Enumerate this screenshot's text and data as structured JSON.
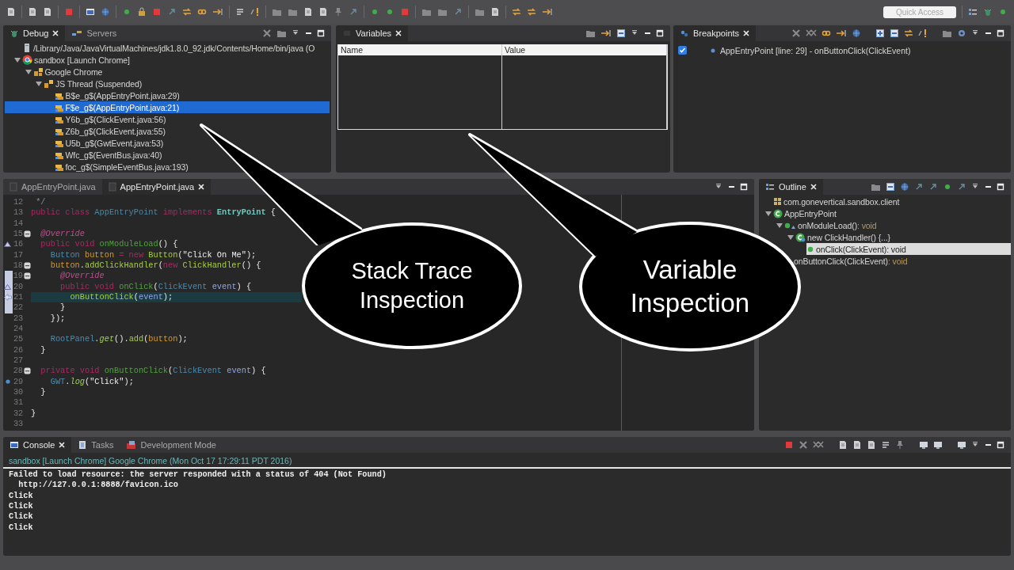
{
  "toolbar": {
    "quick_access": {
      "placeholder": "Quick Access"
    }
  },
  "debug_panel": {
    "tabs": [
      {
        "label": "Debug",
        "selected": true
      },
      {
        "label": "Servers",
        "selected": false
      }
    ],
    "tree": [
      {
        "label": "/Library/Java/JavaVirtualMachines/jdk1.8.0_92.jdk/Contents/Home/bin/java (O",
        "kind": "process",
        "selected": false
      },
      {
        "label": "sandbox [Launch Chrome]",
        "kind": "launch",
        "expanded": true,
        "selected": false,
        "children": [
          {
            "label": "Google Chrome",
            "kind": "target",
            "expanded": true,
            "selected": false,
            "children": [
              {
                "label": "JS Thread (Suspended)",
                "kind": "thread",
                "expanded": true,
                "selected": false,
                "children": [
                  {
                    "label": "B$e_g$(AppEntryPoint.java:29)",
                    "kind": "frame",
                    "selected": false
                  },
                  {
                    "label": "F$e_g$(AppEntryPoint.java:21)",
                    "kind": "frame",
                    "selected": true
                  },
                  {
                    "label": "Y6b_g$(ClickEvent.java:56)",
                    "kind": "frame",
                    "selected": false
                  },
                  {
                    "label": "Z6b_g$(ClickEvent.java:55)",
                    "kind": "frame",
                    "selected": false
                  },
                  {
                    "label": "U5b_g$(GwtEvent.java:53)",
                    "kind": "frame",
                    "selected": false
                  },
                  {
                    "label": "Wfc_g$(EventBus.java:40)",
                    "kind": "frame",
                    "selected": false
                  },
                  {
                    "label": "foc_g$(SimpleEventBus.java:193)",
                    "kind": "frame",
                    "selected": false
                  }
                ]
              }
            ]
          }
        ]
      }
    ]
  },
  "variables_panel": {
    "tabs": [
      {
        "label": "Variables",
        "selected": true
      }
    ],
    "columns": [
      "Name",
      "Value"
    ]
  },
  "breakpoints_panel": {
    "tabs": [
      {
        "label": "Breakpoints",
        "selected": true
      }
    ],
    "items": [
      {
        "label": "AppEntryPoint [line: 29] - onButtonClick(ClickEvent)",
        "checked": true
      }
    ]
  },
  "editor": {
    "tabs": [
      {
        "label": "AppEntryPoint.java",
        "selected": false
      },
      {
        "label": "AppEntryPoint.java",
        "selected": true
      }
    ],
    "lines": [
      {
        "number": "12",
        "in_range": false,
        "tokens": [
          {
            "kind": "comment",
            "text": " */"
          }
        ]
      },
      {
        "number": "13",
        "in_range": false,
        "tokens": [
          {
            "kind": "keyword",
            "text": "public class "
          },
          {
            "kind": "classname",
            "text": "AppEntryPoint "
          },
          {
            "kind": "keyword",
            "text": "implements "
          },
          {
            "kind": "interface",
            "text": "EntryPoint"
          },
          {
            "kind": "plain",
            "text": " {"
          }
        ]
      },
      {
        "number": "14",
        "in_range": false
      },
      {
        "number": "15",
        "kind": "fold",
        "in_range": false,
        "tokens": [
          {
            "kind": "annotation",
            "text": "  @Override"
          }
        ]
      },
      {
        "number": "16",
        "kind": "override",
        "in_range": false,
        "tokens": [
          {
            "kind": "keyword",
            "text": "  public void "
          },
          {
            "kind": "method",
            "text": "onModuleLoad"
          },
          {
            "kind": "plain",
            "text": "() {"
          }
        ]
      },
      {
        "number": "17",
        "in_range": false,
        "tokens": [
          {
            "kind": "type",
            "text": "    Button "
          },
          {
            "kind": "local",
            "text": "button "
          },
          {
            "kind": "keyword",
            "text": "= new "
          },
          {
            "kind": "call",
            "text": "Button"
          },
          {
            "kind": "plain",
            "text": "("
          },
          {
            "kind": "string",
            "text": "\"Click On Me\""
          },
          {
            "kind": "plain",
            "text": ");"
          }
        ]
      },
      {
        "number": "18",
        "kind": "fold",
        "in_range": false,
        "tokens": [
          {
            "kind": "local",
            "text": "    button"
          },
          {
            "kind": "plain",
            "text": "."
          },
          {
            "kind": "call",
            "text": "addClickHandler"
          },
          {
            "kind": "plain",
            "text": "("
          },
          {
            "kind": "keyword",
            "text": "new "
          },
          {
            "kind": "call",
            "text": "ClickHandler"
          },
          {
            "kind": "plain",
            "text": "() {"
          }
        ]
      },
      {
        "number": "19",
        "kind": "fold",
        "in_range": true,
        "tokens": [
          {
            "kind": "annotation",
            "text": "      @Override"
          }
        ]
      },
      {
        "number": "20",
        "kind": "override",
        "in_range": true,
        "tokens": [
          {
            "kind": "keyword",
            "text": "      public void "
          },
          {
            "kind": "method",
            "text": "onClick"
          },
          {
            "kind": "plain",
            "text": "("
          },
          {
            "kind": "type",
            "text": "ClickEvent "
          },
          {
            "kind": "param",
            "text": "event"
          },
          {
            "kind": "plain",
            "text": ") {"
          }
        ]
      },
      {
        "number": "21",
        "kind": "current",
        "in_range": true,
        "tokens": [
          {
            "kind": "call",
            "text": "        onButtonClick"
          },
          {
            "kind": "plain",
            "text": "("
          },
          {
            "kind": "param",
            "text": "event"
          },
          {
            "kind": "plain",
            "text": ");"
          }
        ]
      },
      {
        "number": "22",
        "in_range": true,
        "tokens": [
          {
            "kind": "plain",
            "text": "      }"
          }
        ]
      },
      {
        "number": "23",
        "in_range": false,
        "tokens": [
          {
            "kind": "plain",
            "text": "    });"
          }
        ]
      },
      {
        "number": "24",
        "in_range": false
      },
      {
        "number": "25",
        "in_range": false,
        "tokens": [
          {
            "kind": "type",
            "text": "    RootPanel"
          },
          {
            "kind": "plain",
            "text": "."
          },
          {
            "kind": "static",
            "text": "get"
          },
          {
            "kind": "plain",
            "text": "()."
          },
          {
            "kind": "call",
            "text": "add"
          },
          {
            "kind": "plain",
            "text": "("
          },
          {
            "kind": "local",
            "text": "button"
          },
          {
            "kind": "plain",
            "text": ");"
          }
        ]
      },
      {
        "number": "26",
        "in_range": false,
        "tokens": [
          {
            "kind": "plain",
            "text": "  }"
          }
        ]
      },
      {
        "number": "27",
        "in_range": false
      },
      {
        "number": "28",
        "kind": "fold",
        "in_range": false,
        "tokens": [
          {
            "kind": "keyword",
            "text": "  private void "
          },
          {
            "kind": "method",
            "text": "onButtonClick"
          },
          {
            "kind": "plain",
            "text": "("
          },
          {
            "kind": "type",
            "text": "ClickEvent "
          },
          {
            "kind": "param",
            "text": "event"
          },
          {
            "kind": "plain",
            "text": ") {"
          }
        ]
      },
      {
        "number": "29",
        "kind": "breakpoint",
        "in_range": false,
        "tokens": [
          {
            "kind": "type",
            "text": "    GWT"
          },
          {
            "kind": "plain",
            "text": "."
          },
          {
            "kind": "static",
            "text": "log"
          },
          {
            "kind": "plain",
            "text": "("
          },
          {
            "kind": "string",
            "text": "\"Click\""
          },
          {
            "kind": "plain",
            "text": ");"
          }
        ]
      },
      {
        "number": "30",
        "in_range": false,
        "tokens": [
          {
            "kind": "plain",
            "text": "  }"
          }
        ]
      },
      {
        "number": "31",
        "in_range": false
      },
      {
        "number": "32",
        "in_range": false,
        "tokens": [
          {
            "kind": "plain",
            "text": "}"
          }
        ]
      },
      {
        "number": "33",
        "in_range": false
      }
    ]
  },
  "outline_panel": {
    "tabs": [
      {
        "label": "Outline",
        "selected": true
      }
    ],
    "tree": [
      {
        "label": "com.gonevertical.sandbox.client",
        "kind": "package",
        "selected": false
      },
      {
        "label": "AppEntryPoint",
        "kind": "class",
        "expanded": true,
        "selected": false,
        "children": [
          {
            "label": "onModuleLoad()",
            "type": " : void",
            "kind": "public-method",
            "expanded": true,
            "selected": false,
            "children": [
              {
                "label": "new ClickHandler() {...}",
                "kind": "anonymous-class",
                "expanded": true,
                "selected": false,
                "children": [
                  {
                    "label": "onClick(ClickEvent)",
                    "type": " : void",
                    "kind": "method",
                    "selected": true
                  }
                ]
              }
            ]
          },
          {
            "label": "onButtonClick(ClickEvent)",
            "type": " : void",
            "kind": "private-method",
            "selected": false
          }
        ]
      }
    ]
  },
  "console_panel": {
    "tabs": [
      {
        "label": "Console",
        "selected": true
      },
      {
        "label": "Tasks",
        "selected": false
      },
      {
        "label": "Development Mode",
        "selected": false
      }
    ],
    "process": "sandbox [Launch Chrome] Google Chrome (Mon Oct 17 17:29:11 PDT 2016)",
    "output": [
      "Failed to load resource: the server responded with a status of 404 (Not Found)",
      "  http://127.0.0.1:8888/favicon.ico",
      "Click",
      "Click",
      "Click",
      "Click"
    ]
  },
  "callouts": [
    {
      "text": "Stack Trace Inspection"
    },
    {
      "text": "Variable Inspection"
    }
  ]
}
